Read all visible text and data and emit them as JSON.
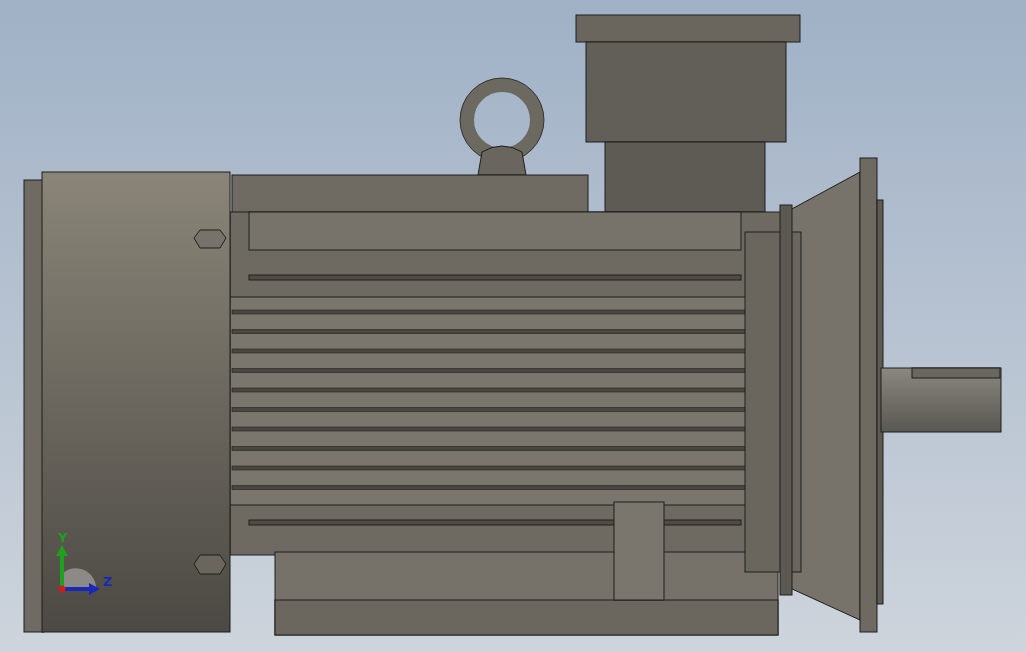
{
  "viewport": {
    "triad": {
      "axes": [
        {
          "label": "Y",
          "color": "#1fa01f",
          "kind": "vertical"
        },
        {
          "label": "Z",
          "color": "#1a28b8",
          "kind": "horizontal"
        }
      ]
    }
  }
}
